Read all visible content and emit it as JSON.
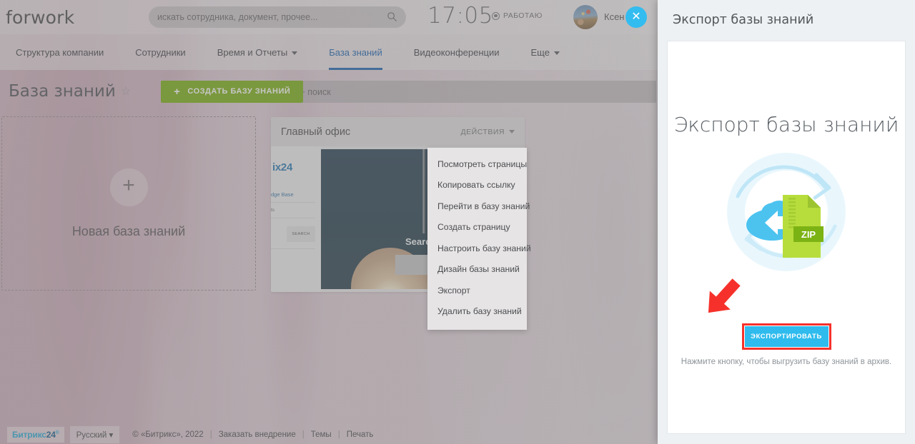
{
  "header": {
    "logo": "forwork",
    "search_placeholder": "искать сотрудника, документ, прочее...",
    "search_icon": "search-icon",
    "clock": "17:05",
    "status_label": "РАБОТАЮ",
    "status_icon": "record-dot-icon",
    "user_name": "Ксен",
    "close_label": "✕"
  },
  "nav": {
    "items": [
      {
        "label": "Структура компании",
        "active": false,
        "caret": false
      },
      {
        "label": "Сотрудники",
        "active": false,
        "caret": false
      },
      {
        "label": "Время и Отчеты",
        "active": false,
        "caret": true
      },
      {
        "label": "База знаний",
        "active": true,
        "caret": false
      },
      {
        "label": "Видеоконференции",
        "active": false,
        "caret": false
      },
      {
        "label": "Еще",
        "active": false,
        "caret": true
      }
    ],
    "active_color": "#2067b0"
  },
  "toolbar": {
    "page_title": "База знаний",
    "star_icon": "star-outline-icon",
    "create_label": "СОЗДАТЬ БАЗУ ЗНАНИЙ",
    "create_plus": "+",
    "create_color": "#7cb014",
    "filter_placeholder": "Фильтр + поиск"
  },
  "content": {
    "new_kb": {
      "plus": "+",
      "label": "Новая база знаний"
    },
    "kb_card": {
      "name": "Главный офис",
      "actions_label": "ДЕЙСТВИЯ",
      "actions_caret_icon": "chevron-down-icon",
      "thumb": {
        "logo": "ix24",
        "nav_item_1": "dge Base",
        "nav_item_2": "ts",
        "search_button": "SEARCH",
        "hero_text": "Search in"
      }
    }
  },
  "dropdown": {
    "items": [
      "Посмотреть страницы",
      "Копировать ссылку",
      "Перейти в базу знаний",
      "Создать страницу",
      "Настроить базу знаний",
      "Дизайн базы знаний",
      "Экспорт",
      "Удалить базу знаний"
    ]
  },
  "footer": {
    "brand": "Битрикс",
    "brand_num": "24",
    "brand_sup": "®",
    "language": "Русский",
    "language_caret": "▾",
    "copyright": "© «Битрикс», 2022",
    "links": [
      "Заказать внедрение",
      "Темы",
      "Печать"
    ]
  },
  "slider": {
    "title": "Экспорт базы знаний",
    "heading": "Экспорт базы знаний",
    "illustration_icon": "cloud-download-zip-icon",
    "zip_label": "ZIP",
    "export_button": "ЭКСПОРТИРОВАТЬ",
    "export_button_color": "#2fbbed",
    "highlight_color": "#f6312b",
    "hint": "Нажмите кнопку, чтобы выгрузить базу знаний в архив.",
    "annotation_arrow_icon": "red-arrow-icon"
  }
}
